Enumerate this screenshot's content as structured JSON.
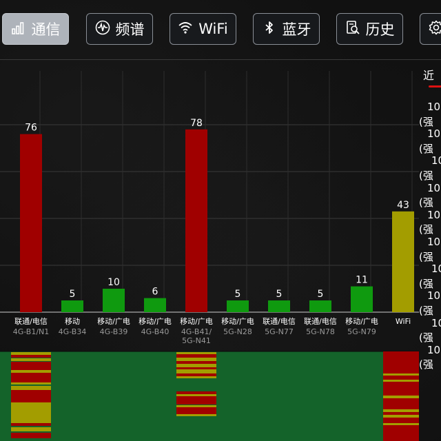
{
  "toolbar": {
    "tabs": [
      {
        "label": "通信",
        "icon": "signal-bars-icon",
        "active": true
      },
      {
        "label": "频谱",
        "icon": "waveform-icon",
        "active": false
      },
      {
        "label": "WiFi",
        "icon": "wifi-icon",
        "active": false
      },
      {
        "label": "蓝牙",
        "icon": "bluetooth-icon",
        "active": false
      },
      {
        "label": "历史",
        "icon": "history-search-icon",
        "active": false
      },
      {
        "label": "",
        "icon": "gear-icon",
        "active": false
      }
    ]
  },
  "chart_data": {
    "type": "bar",
    "ylim": [
      0,
      100
    ],
    "grid": true,
    "bars": [
      {
        "carrier": "联通/电信",
        "band": "4G-B1/N1",
        "value": 76,
        "color": "#a00000"
      },
      {
        "carrier": "移动",
        "band": "4G-B34",
        "value": 5,
        "color": "#0f9a0f"
      },
      {
        "carrier": "移动/广电",
        "band": "4G-B39",
        "value": 10,
        "color": "#0f9a0f"
      },
      {
        "carrier": "移动/广电",
        "band": "4G-B40",
        "value": 6,
        "color": "#0f9a0f"
      },
      {
        "carrier": "移动/广电",
        "band": "4G-B41/5G-N41",
        "value": 78,
        "color": "#a00000"
      },
      {
        "carrier": "移动/广电",
        "band": "5G-N28",
        "value": 5,
        "color": "#0f9a0f"
      },
      {
        "carrier": "联通/电信",
        "band": "5G-N77",
        "value": 5,
        "color": "#0f9a0f"
      },
      {
        "carrier": "联通/电信",
        "band": "5G-N78",
        "value": 5,
        "color": "#0f9a0f"
      },
      {
        "carrier": "移动/广电",
        "band": "5G-N79",
        "value": 11,
        "color": "#0f9a0f"
      },
      {
        "carrier": "",
        "band": "WiFi",
        "value": 43,
        "color": "#a39d00"
      }
    ],
    "colors": {
      "high": "#a00000",
      "low": "#0f9a0f",
      "wifi": "#a39d00",
      "waterfall_bg": "#14632a"
    }
  },
  "side_panel": {
    "title": "近",
    "entries": [
      "10:",
      "(强",
      "10:",
      "(强",
      "10",
      "(强",
      "10:",
      "(强",
      "10:",
      "(强",
      "10:",
      "(强",
      "10",
      "(强",
      "10:",
      "(强",
      "10",
      "(强",
      "10:",
      "(强"
    ]
  }
}
